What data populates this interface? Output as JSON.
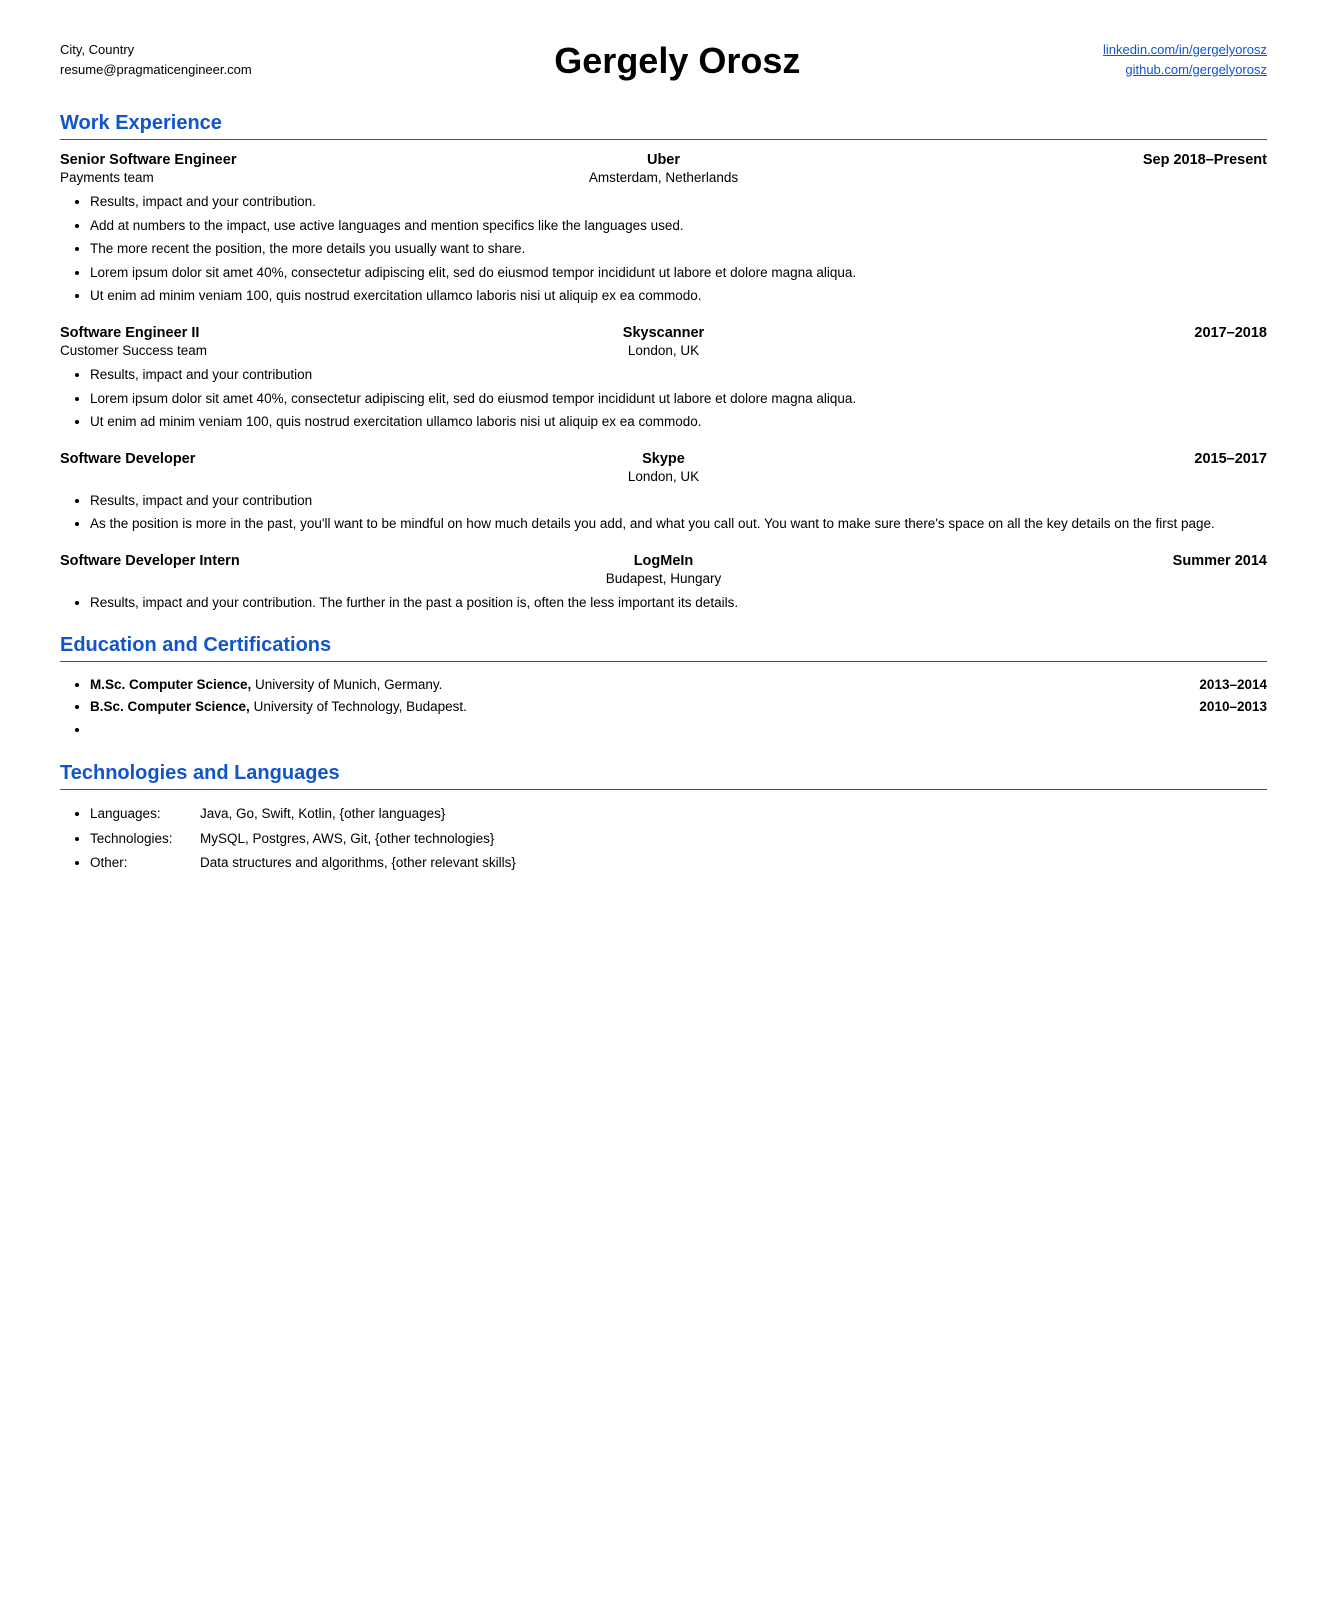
{
  "header": {
    "left_line1": "City, Country",
    "left_line2": "resume@pragmaticengineer.com",
    "name": "Gergely Orosz",
    "right_link1": "linkedin.com/in/gergelyorosz",
    "right_link2": "github.com/gergelyorosz"
  },
  "sections": {
    "work_experience": {
      "title": "Work Experience",
      "jobs": [
        {
          "title": "Senior Software Engineer",
          "company": "Uber",
          "date": "Sep 2018–Present",
          "team": "Payments team",
          "location": "Amsterdam, Netherlands",
          "bullets": [
            "Results, impact and your contribution.",
            "Add at numbers to the impact, use active languages and mention specifics like the languages used.",
            "The more recent the position, the more details you usually want to share.",
            "Lorem ipsum dolor sit amet 40%, consectetur adipiscing elit, sed do eiusmod tempor incididunt ut labore et dolore magna aliqua.",
            "Ut enim ad minim veniam 100, quis nostrud exercitation ullamco laboris nisi ut aliquip ex ea commodo."
          ]
        },
        {
          "title": "Software Engineer II",
          "company": "Skyscanner",
          "date": "2017–2018",
          "team": "Customer Success team",
          "location": "London, UK",
          "bullets": [
            "Results, impact and your contribution",
            "Lorem ipsum dolor sit amet 40%, consectetur adipiscing elit, sed do eiusmod tempor incididunt ut labore et dolore magna aliqua.",
            "Ut enim ad minim veniam 100, quis nostrud exercitation ullamco laboris nisi ut aliquip ex ea commodo."
          ]
        },
        {
          "title": "Software Developer",
          "company": "Skype",
          "date": "2015–2017",
          "team": "",
          "location": "London, UK",
          "bullets": [
            "Results, impact and your contribution",
            "As the position is more in the past, you'll want to be mindful on how much details you add, and what you call out. You want to make sure there's space on all the key details on the first page."
          ]
        },
        {
          "title": "Software Developer Intern",
          "company": "LogMeIn",
          "date": "Summer 2014",
          "team": "",
          "location": "Budapest, Hungary",
          "bullets": [
            "Results, impact and your contribution. The further in the past a position is, often the less important its details."
          ]
        }
      ]
    },
    "education": {
      "title": "Education and Certifications",
      "items": [
        {
          "text": "<b>M.Sc. Computer Science,</b> University of Munich, Germany.",
          "text_plain": "M.Sc. Computer Science, University of Munich, Germany.",
          "bold_part": "M.Sc. Computer Science,",
          "rest": " University of Munich, Germany.",
          "date": "2013–2014"
        },
        {
          "text": "<b>B.Sc. Computer Science,</b> University of Technology, Budapest.",
          "bold_part": "B.Sc. Computer Science,",
          "rest": " University of Technology, Budapest.",
          "date": "2010–2013"
        },
        {
          "text": "",
          "bold_part": "",
          "rest": "",
          "date": ""
        }
      ]
    },
    "technologies": {
      "title": "Technologies and Languages",
      "items": [
        {
          "label": "Languages:",
          "value": "Java, Go, Swift, Kotlin, {other languages}"
        },
        {
          "label": "Technologies:",
          "value": "MySQL, Postgres, AWS, Git, {other technologies}"
        },
        {
          "label": "Other:",
          "value": "Data structures and algorithms, {other relevant skills}"
        }
      ]
    }
  }
}
